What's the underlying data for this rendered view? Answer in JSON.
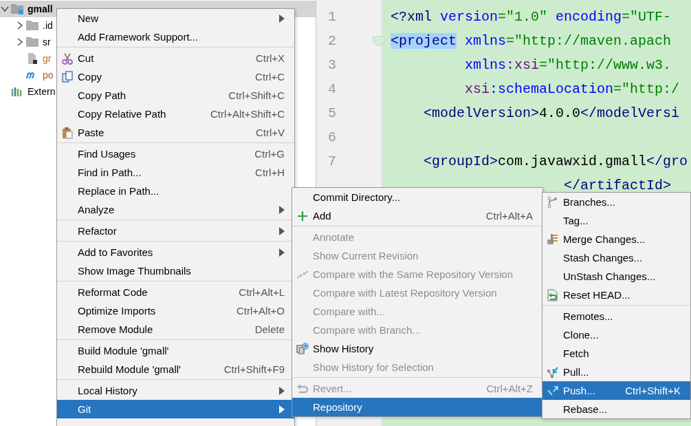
{
  "project_tree": {
    "items": [
      {
        "label": "gmall",
        "selected": true,
        "expanded": true,
        "color": "#000000",
        "children": [
          {
            "label": ".id",
            "selected": false,
            "expanded": false,
            "color": "#000000"
          },
          {
            "label": "sr",
            "selected": false,
            "expanded": false,
            "color": "#000000"
          },
          {
            "label": "gr",
            "selected": false,
            "color": "#c27221"
          },
          {
            "label": "po",
            "selected": false,
            "color": "#b4581f"
          }
        ]
      },
      {
        "label": "Extern",
        "selected": false,
        "color": "#000000"
      }
    ]
  },
  "editor": {
    "lines": [
      {
        "number": "1",
        "tokens": [
          {
            "text": "<?xml",
            "kind": "tag"
          },
          {
            "text": " version",
            "kind": "attr"
          },
          {
            "text": "=\"1.0\"",
            "kind": "value"
          },
          {
            "text": " encoding",
            "kind": "attr"
          },
          {
            "text": "=\"UTF-",
            "kind": "value"
          }
        ]
      },
      {
        "number": "2",
        "foldable": true,
        "tokens": [
          {
            "text": "<project",
            "kind": "tag",
            "highlighted": true
          },
          {
            "text": " xmlns",
            "kind": "attr"
          },
          {
            "text": "=\"http://maven.apach",
            "kind": "value"
          }
        ]
      },
      {
        "number": "3",
        "tokens": [
          {
            "text": "         xmlns",
            "kind": "attr"
          },
          {
            "text": ":xsi",
            "kind": "ns"
          },
          {
            "text": "=\"http://www.w3.",
            "kind": "value"
          }
        ]
      },
      {
        "number": "4",
        "tokens": [
          {
            "text": "         xsi",
            "kind": "ns"
          },
          {
            "text": ":schemaLocation",
            "kind": "attr"
          },
          {
            "text": "=\"http:/",
            "kind": "value"
          }
        ]
      },
      {
        "number": "5",
        "tokens": [
          {
            "text": "    <modelVersion>",
            "kind": "tag"
          },
          {
            "text": "4.0.0",
            "kind": "text"
          },
          {
            "text": "</modelVersi",
            "kind": "tag"
          }
        ]
      },
      {
        "number": "6"
      },
      {
        "number": "7",
        "tokens": [
          {
            "text": "    <groupId>",
            "kind": "tag"
          },
          {
            "text": "com.javawxid.gmall",
            "kind": "text"
          },
          {
            "text": "</gro",
            "kind": "tag"
          }
        ]
      },
      {
        "tokens": [
          {
            "text": "                     </artifactId>",
            "kind": "tag"
          }
        ]
      }
    ]
  },
  "context_menu": {
    "groups": [
      [
        {
          "label": "New",
          "submenu": true,
          "selected": false
        },
        {
          "label": "Add Framework Support...",
          "submenu": false,
          "selected": false
        }
      ],
      [
        {
          "label": "Cut",
          "shortcut": "Ctrl+X",
          "submenu": false,
          "selected": false
        },
        {
          "label": "Copy",
          "shortcut": "Ctrl+C",
          "submenu": false,
          "selected": false
        },
        {
          "label": "Copy Path",
          "shortcut": "Ctrl+Shift+C",
          "submenu": false,
          "selected": false
        },
        {
          "label": "Copy Relative Path",
          "shortcut": "Ctrl+Alt+Shift+C",
          "submenu": false,
          "selected": false
        },
        {
          "label": "Paste",
          "shortcut": "Ctrl+V",
          "submenu": false,
          "selected": false
        }
      ],
      [
        {
          "label": "Find Usages",
          "shortcut": "Ctrl+G",
          "submenu": false,
          "selected": false
        },
        {
          "label": "Find in Path...",
          "shortcut": "Ctrl+H",
          "submenu": false,
          "selected": false
        },
        {
          "label": "Replace in Path...",
          "submenu": false,
          "selected": false
        },
        {
          "label": "Analyze",
          "submenu": true,
          "selected": false
        }
      ],
      [
        {
          "label": "Refactor",
          "submenu": true,
          "selected": false
        }
      ],
      [
        {
          "label": "Add to Favorites",
          "submenu": true,
          "selected": false
        },
        {
          "label": "Show Image Thumbnails",
          "submenu": false,
          "selected": false
        }
      ],
      [
        {
          "label": "Reformat Code",
          "shortcut": "Ctrl+Alt+L",
          "submenu": false,
          "selected": false
        },
        {
          "label": "Optimize Imports",
          "shortcut": "Ctrl+Alt+O",
          "submenu": false,
          "selected": false
        },
        {
          "label": "Remove Module",
          "shortcut": "Delete",
          "submenu": false,
          "selected": false
        }
      ],
      [
        {
          "label": "Build Module 'gmall'",
          "submenu": false,
          "selected": false
        },
        {
          "label": "Rebuild Module 'gmall'",
          "shortcut": "Ctrl+Shift+F9",
          "submenu": false,
          "selected": false
        }
      ],
      [
        {
          "label": "Local History",
          "submenu": true,
          "selected": false
        },
        {
          "label": "Git",
          "submenu": true,
          "selected": true
        }
      ]
    ]
  },
  "git_submenu": {
    "groups": [
      [
        {
          "label": "Commit Directory...",
          "disabled": false,
          "selected": false
        },
        {
          "label": "Add",
          "shortcut": "Ctrl+Alt+A",
          "disabled": false,
          "selected": false
        }
      ],
      [
        {
          "label": "Annotate",
          "disabled": true,
          "selected": false
        },
        {
          "label": "Show Current Revision",
          "disabled": true,
          "selected": false
        },
        {
          "label": "Compare with the Same Repository Version",
          "disabled": true,
          "selected": false
        },
        {
          "label": "Compare with Latest Repository Version",
          "disabled": true,
          "selected": false
        },
        {
          "label": "Compare with...",
          "disabled": true,
          "selected": false
        },
        {
          "label": "Compare with Branch...",
          "disabled": true,
          "selected": false
        },
        {
          "label": "Show History",
          "disabled": false,
          "selected": false
        },
        {
          "label": "Show History for Selection",
          "disabled": true,
          "selected": false
        }
      ],
      [
        {
          "label": "Revert...",
          "shortcut": "Ctrl+Alt+Z",
          "disabled": true,
          "selected": false
        },
        {
          "label": "Repository",
          "disabled": false,
          "selected": true
        }
      ]
    ]
  },
  "repository_submenu": {
    "groups": [
      [
        {
          "label": "Branches...",
          "selected": false
        },
        {
          "label": "Tag...",
          "selected": false
        },
        {
          "label": "Merge Changes...",
          "selected": false
        },
        {
          "label": "Stash Changes...",
          "selected": false
        },
        {
          "label": "UnStash Changes...",
          "selected": false
        },
        {
          "label": "Reset HEAD...",
          "selected": false
        }
      ],
      [
        {
          "label": "Remotes...",
          "selected": false
        },
        {
          "label": "Clone...",
          "selected": false
        },
        {
          "label": "Fetch",
          "selected": false
        },
        {
          "label": "Pull...",
          "selected": false
        },
        {
          "label": "Push...",
          "shortcut": "Ctrl+Shift+K",
          "selected": true
        },
        {
          "label": "Rebase...",
          "selected": false
        }
      ]
    ]
  }
}
